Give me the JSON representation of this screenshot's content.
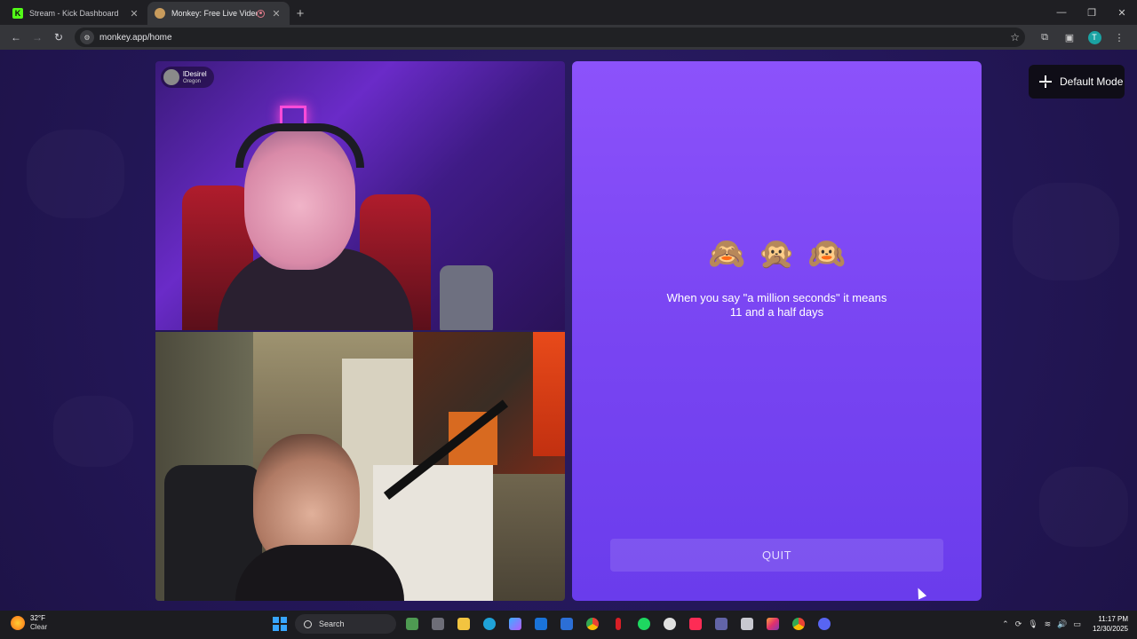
{
  "browser": {
    "tabs": [
      {
        "title": "Stream - Kick Dashboard",
        "favicon": "kick-icon",
        "active": false
      },
      {
        "title": "Monkey: Free Live Video Ch",
        "favicon": "monkey-icon",
        "active": true
      }
    ],
    "url": "monkey.app/home"
  },
  "remote_user": {
    "name": "lDesirel",
    "location": "Oregon"
  },
  "panel": {
    "emojis": [
      "🙈",
      "🙊",
      "🙉"
    ],
    "fact": "When you say \"a million seconds\" it means 11 and a half days",
    "quit_label": "QUIT",
    "color": "#7b46f3"
  },
  "mode_button": {
    "label": "Default Mode"
  },
  "taskbar": {
    "weather": {
      "temp": "32°F",
      "condition": "Clear"
    },
    "search_label": "Search",
    "time": "11:17 PM",
    "date": "12/30/2025"
  }
}
